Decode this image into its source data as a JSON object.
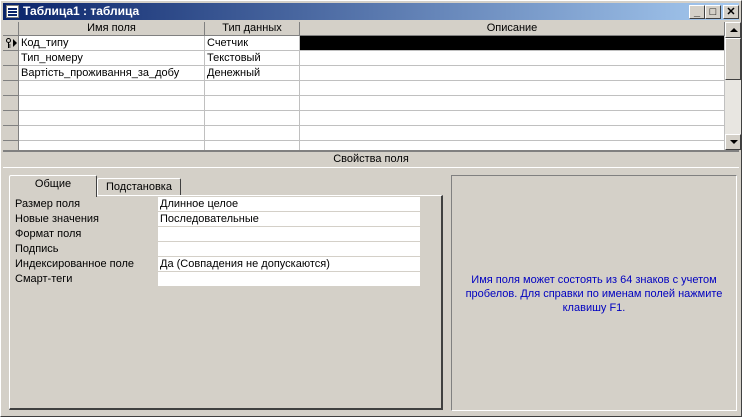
{
  "window": {
    "title": "Таблица1 : таблица",
    "controls": {
      "minimize": "_",
      "maximize": "□",
      "close": "✕"
    }
  },
  "grid": {
    "headers": [
      "Имя поля",
      "Тип данных",
      "Описание"
    ],
    "rows": [
      {
        "name": "Код_типу",
        "type": "Счетчик",
        "description": "",
        "primary_key": true,
        "active": true
      },
      {
        "name": "Тип_номеру",
        "type": "Текстовый",
        "description": ""
      },
      {
        "name": "Вартість_проживання_за_добу",
        "type": "Денежный",
        "description": ""
      }
    ]
  },
  "properties": {
    "title": "Свойства поля",
    "tabs": [
      {
        "label": "Общие",
        "active": true
      },
      {
        "label": "Подстановка",
        "active": false
      }
    ],
    "fields": [
      {
        "label": "Размер поля",
        "value": "Длинное целое"
      },
      {
        "label": "Новые значения",
        "value": "Последовательные"
      },
      {
        "label": "Формат поля",
        "value": ""
      },
      {
        "label": "Подпись",
        "value": ""
      },
      {
        "label": "Индексированное поле",
        "value": "Да (Совпадения не допускаются)"
      },
      {
        "label": "Смарт-теги",
        "value": ""
      }
    ]
  },
  "help": {
    "text": "Имя поля может состоять из 64 знаков с учетом пробелов.  Для справки по именам полей нажмите клавишу F1."
  },
  "colors": {
    "titlebar_start": "#0a246a",
    "titlebar_end": "#a6caf0",
    "help_text": "#0000c0",
    "face": "#d4d0c8"
  }
}
